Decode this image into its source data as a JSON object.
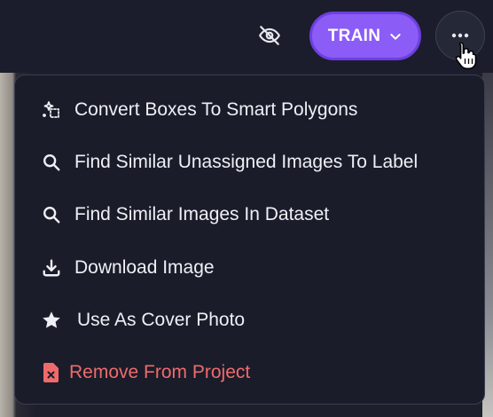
{
  "toolbar": {
    "train_label": "TRAIN",
    "icons": [
      "eye-off-icon",
      "chevron-down-icon",
      "more-horizontal-icon"
    ]
  },
  "menu": {
    "items": [
      {
        "label": "Convert Boxes To Smart Polygons",
        "icon": "sparkle-polygon-icon"
      },
      {
        "label": "Find Similar Unassigned Images To Label",
        "icon": "search-icon"
      },
      {
        "label": "Find Similar Images In Dataset",
        "icon": "search-icon"
      },
      {
        "label": "Download Image",
        "icon": "download-icon"
      },
      {
        "label": "Use As Cover Photo",
        "icon": "star-icon"
      },
      {
        "label": "Remove From Project",
        "icon": "file-remove-icon"
      }
    ]
  },
  "colors": {
    "background": "#1b1d2c",
    "menu_bg": "#1a1c2a",
    "accent": "#8b5cf6",
    "text": "#eef0f5",
    "danger": "#ef6b6b"
  }
}
